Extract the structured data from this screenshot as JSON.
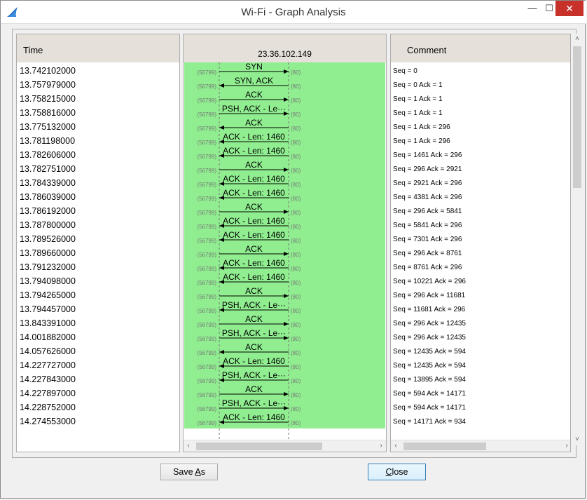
{
  "window": {
    "title": "Wi-Fi - Graph Analysis",
    "minimize_glyph": "🗕",
    "maximize_glyph": "☐",
    "close_glyph": "✕",
    "app_icon": "wireshark-fin-icon"
  },
  "time_pane": {
    "header": "Time",
    "times": [
      "13.742102000",
      "13.757979000",
      "13.758215000",
      "13.758816000",
      "13.775132000",
      "13.781198000",
      "13.782606000",
      "13.782751000",
      "13.784339000",
      "13.786039000",
      "13.786192000",
      "13.787800000",
      "13.789526000",
      "13.789660000",
      "13.791232000",
      "13.794098000",
      "13.794265000",
      "13.794457000",
      "13.843391000",
      "14.001882000",
      "14.057626000",
      "14.227727000",
      "14.227843000",
      "14.227897000",
      "14.228752000",
      "14.274553000"
    ]
  },
  "graph_pane": {
    "host": "23.36.102.149",
    "left_port": "(56799)",
    "right_port": "(80)",
    "background_color": "#90ee90",
    "rows": [
      {
        "label": "SYN",
        "dir": "right"
      },
      {
        "label": "SYN, ACK",
        "dir": "left"
      },
      {
        "label": "ACK",
        "dir": "right"
      },
      {
        "label": "PSH, ACK - Le···",
        "dir": "right"
      },
      {
        "label": "ACK",
        "dir": "left"
      },
      {
        "label": "ACK - Len: 1460",
        "dir": "left"
      },
      {
        "label": "ACK - Len: 1460",
        "dir": "left"
      },
      {
        "label": "ACK",
        "dir": "right"
      },
      {
        "label": "ACK - Len: 1460",
        "dir": "left"
      },
      {
        "label": "ACK - Len: 1460",
        "dir": "left"
      },
      {
        "label": "ACK",
        "dir": "right"
      },
      {
        "label": "ACK - Len: 1460",
        "dir": "left"
      },
      {
        "label": "ACK - Len: 1460",
        "dir": "left"
      },
      {
        "label": "ACK",
        "dir": "right"
      },
      {
        "label": "ACK - Len: 1460",
        "dir": "left"
      },
      {
        "label": "ACK - Len: 1460",
        "dir": "left"
      },
      {
        "label": "ACK",
        "dir": "right"
      },
      {
        "label": "PSH, ACK - Le···",
        "dir": "left"
      },
      {
        "label": "ACK",
        "dir": "right"
      },
      {
        "label": "PSH, ACK - Le···",
        "dir": "right"
      },
      {
        "label": "ACK",
        "dir": "left"
      },
      {
        "label": "ACK - Len: 1460",
        "dir": "left"
      },
      {
        "label": "PSH, ACK - Le···",
        "dir": "left"
      },
      {
        "label": "ACK",
        "dir": "right"
      },
      {
        "label": "PSH, ACK - Le···",
        "dir": "right"
      },
      {
        "label": "ACK - Len: 1460",
        "dir": "left"
      }
    ]
  },
  "comment_pane": {
    "header": "Comment",
    "comments": [
      "Seq = 0",
      "Seq = 0 Ack = 1",
      "Seq = 1 Ack = 1",
      "Seq = 1 Ack = 1",
      "Seq = 1 Ack = 296",
      "Seq = 1 Ack = 296",
      "Seq = 1461 Ack = 296",
      "Seq = 296 Ack = 2921",
      "Seq = 2921 Ack = 296",
      "Seq = 4381 Ack = 296",
      "Seq = 296 Ack = 5841",
      "Seq = 5841 Ack = 296",
      "Seq = 7301 Ack = 296",
      "Seq = 296 Ack = 8761",
      "Seq = 8761 Ack = 296",
      "Seq = 10221 Ack = 296",
      "Seq = 296 Ack = 11681",
      "Seq = 11681 Ack = 296",
      "Seq = 296 Ack = 12435",
      "Seq = 296 Ack = 12435",
      "Seq = 12435 Ack = 594",
      "Seq = 12435 Ack = 594",
      "Seq = 13895 Ack = 594",
      "Seq = 594 Ack = 14171",
      "Seq = 594 Ack = 14171",
      "Seq = 14171 Ack = 934"
    ]
  },
  "buttons": {
    "save_as_prefix": "Save ",
    "save_as_mnemonic": "A",
    "save_as_suffix": "s",
    "close_mnemonic": "C",
    "close_suffix": "lose"
  },
  "scroll": {
    "left_arrow": "‹",
    "right_arrow": "›",
    "up_arrow": "˄",
    "down_arrow": "˅"
  }
}
